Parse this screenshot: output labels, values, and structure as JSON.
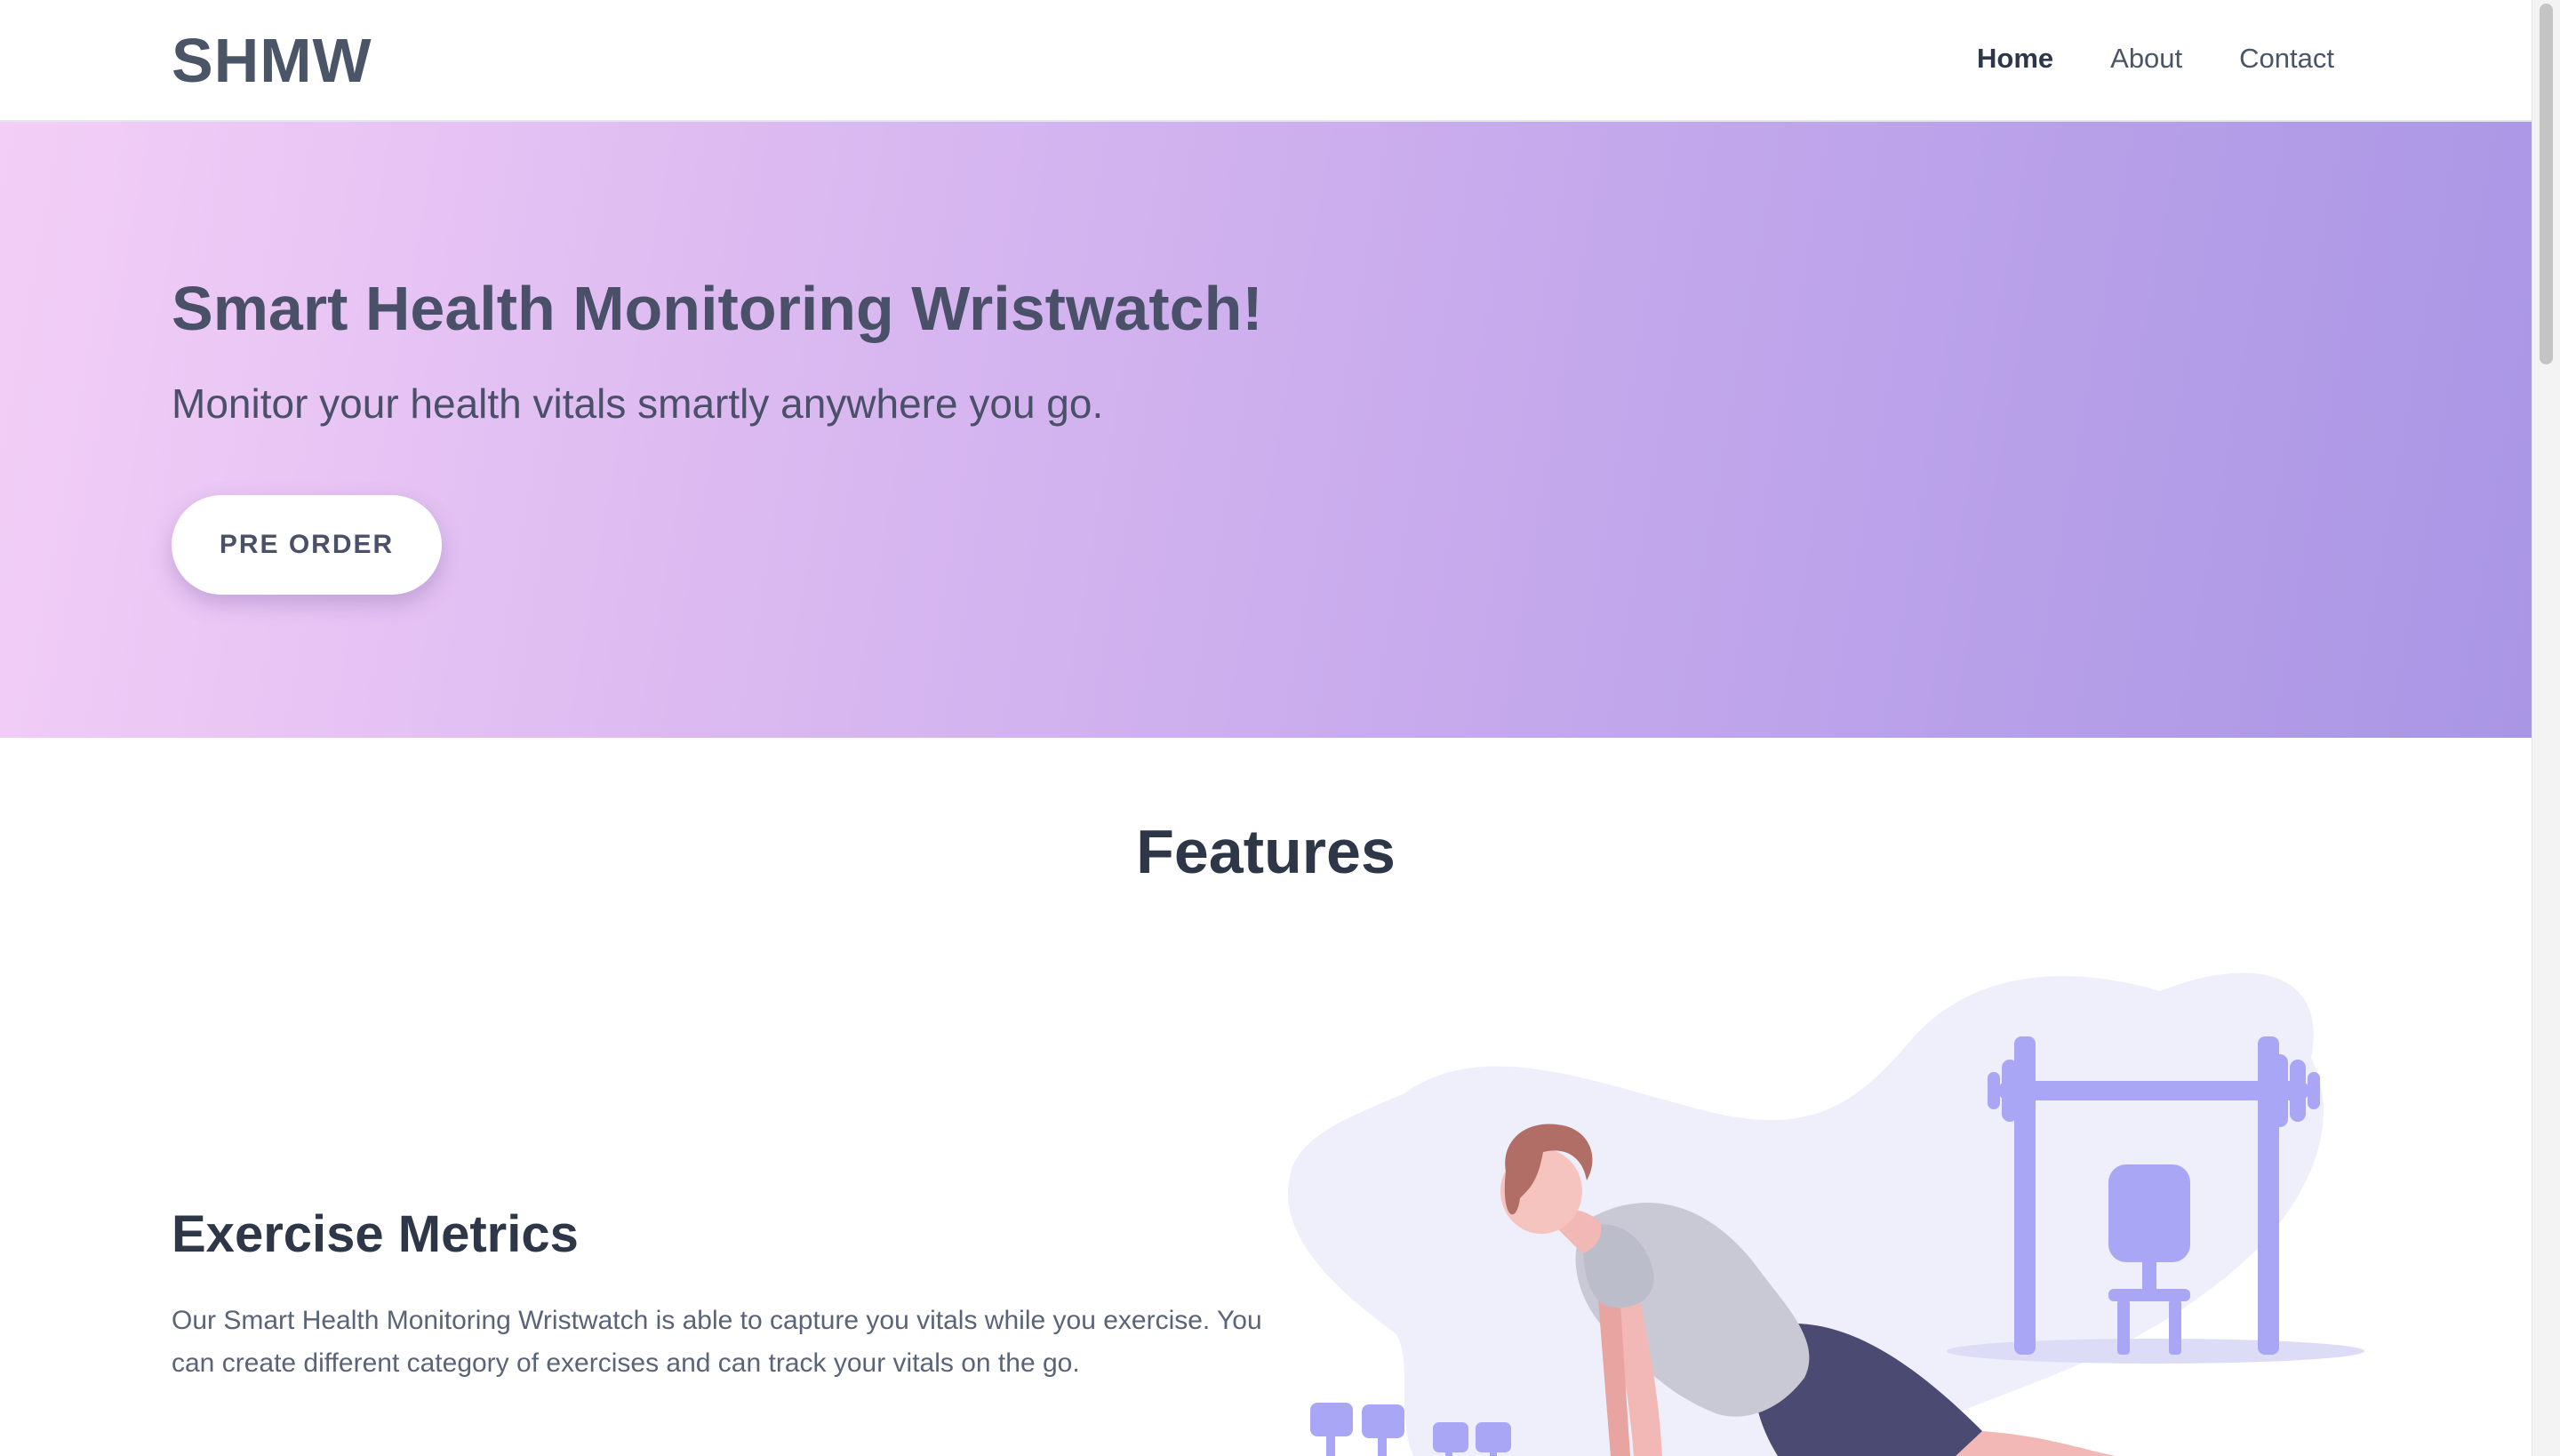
{
  "header": {
    "logo": "SHMW",
    "nav": [
      {
        "label": "Home",
        "active": true
      },
      {
        "label": "About",
        "active": false
      },
      {
        "label": "Contact",
        "active": false
      }
    ]
  },
  "hero": {
    "title": "Smart Health Monitoring Wristwatch!",
    "subtitle": "Monitor your health vitals smartly anywhere you go.",
    "cta_label": "PRE ORDER",
    "gradient_colors": [
      "#f3cff7",
      "#a996e5"
    ]
  },
  "features": {
    "section_title": "Features",
    "items": [
      {
        "heading": "Exercise Metrics",
        "text": "Our Smart Health Monitoring Wristwatch is able to capture you vitals while you exercise. You can create different category of exercises and can track your vitals on the go.",
        "illustration": "man-doing-pushups-illustration"
      }
    ]
  },
  "colors": {
    "accent": "#a9a6f5",
    "text_dark": "#2d3748",
    "text_body": "#4a5568"
  }
}
